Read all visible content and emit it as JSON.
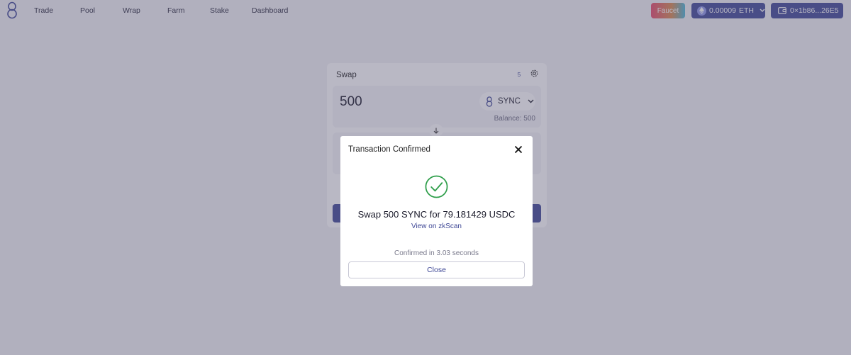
{
  "nav": {
    "items": [
      "Trade",
      "Pool",
      "Wrap",
      "Farm",
      "Stake",
      "Dashboard"
    ],
    "faucet_label": "Faucet",
    "eth_balance": "0.00009",
    "eth_symbol": "ETH",
    "wallet_address": "0×1b86...26E5"
  },
  "swap": {
    "title": "Swap",
    "slippage_badge": "5",
    "input_amount": "500",
    "input_token": "SYNC",
    "input_balance": "Balance: 500"
  },
  "modal": {
    "title": "Transaction Confirmed",
    "summary": "Swap 500 SYNC for 79.181429 USDC",
    "link": "View on zkScan",
    "confirmed_time": "Confirmed in 3.03 seconds",
    "close_label": "Close"
  },
  "colors": {
    "primary": "#3f4896",
    "success": "#2e9e4a"
  },
  "icons": {
    "logo": "syncswap-logo-icon",
    "eth": "ethereum-icon",
    "wallet": "wallet-icon",
    "settings": "gear-icon",
    "token": "sync-token-icon",
    "chevron": "chevron-down-icon",
    "arrow": "arrow-down-icon",
    "close": "close-icon",
    "success": "check-circle-icon"
  }
}
